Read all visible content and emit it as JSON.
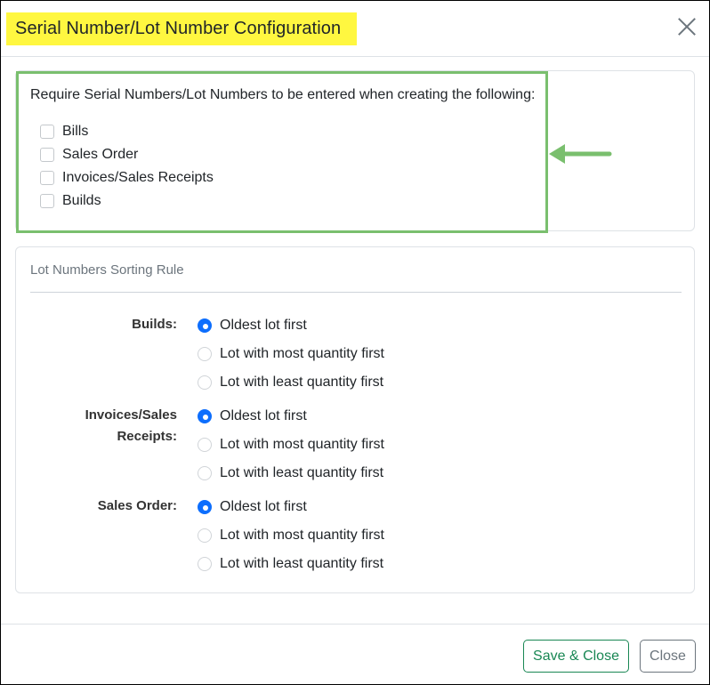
{
  "dialog": {
    "title": "Serial Number/Lot Number Configuration"
  },
  "require_section": {
    "instruction": "Require Serial Numbers/Lot Numbers to be entered when creating the following:",
    "options": [
      {
        "label": "Bills",
        "checked": false
      },
      {
        "label": "Sales Order",
        "checked": false
      },
      {
        "label": "Invoices/Sales Receipts",
        "checked": false
      },
      {
        "label": "Builds",
        "checked": false
      }
    ]
  },
  "sorting_section": {
    "title": "Lot Numbers Sorting Rule",
    "groups": [
      {
        "label": "Builds:",
        "options": [
          "Oldest lot first",
          "Lot with most quantity first",
          "Lot with least quantity first"
        ],
        "selected": 0
      },
      {
        "label_line1": "Invoices/Sales",
        "label_line2": "Receipts:",
        "options": [
          "Oldest lot first",
          "Lot with most quantity first",
          "Lot with least quantity first"
        ],
        "selected": 0
      },
      {
        "label": "Sales Order:",
        "options": [
          "Oldest lot first",
          "Lot with most quantity first",
          "Lot with least quantity first"
        ],
        "selected": 0
      }
    ]
  },
  "footer": {
    "save_label": "Save & Close",
    "close_label": "Close"
  },
  "colors": {
    "highlight_title": "#fff740",
    "annotation_green": "#7abf6e",
    "radio_selected": "#0d6efd",
    "save_button": "#198754"
  }
}
